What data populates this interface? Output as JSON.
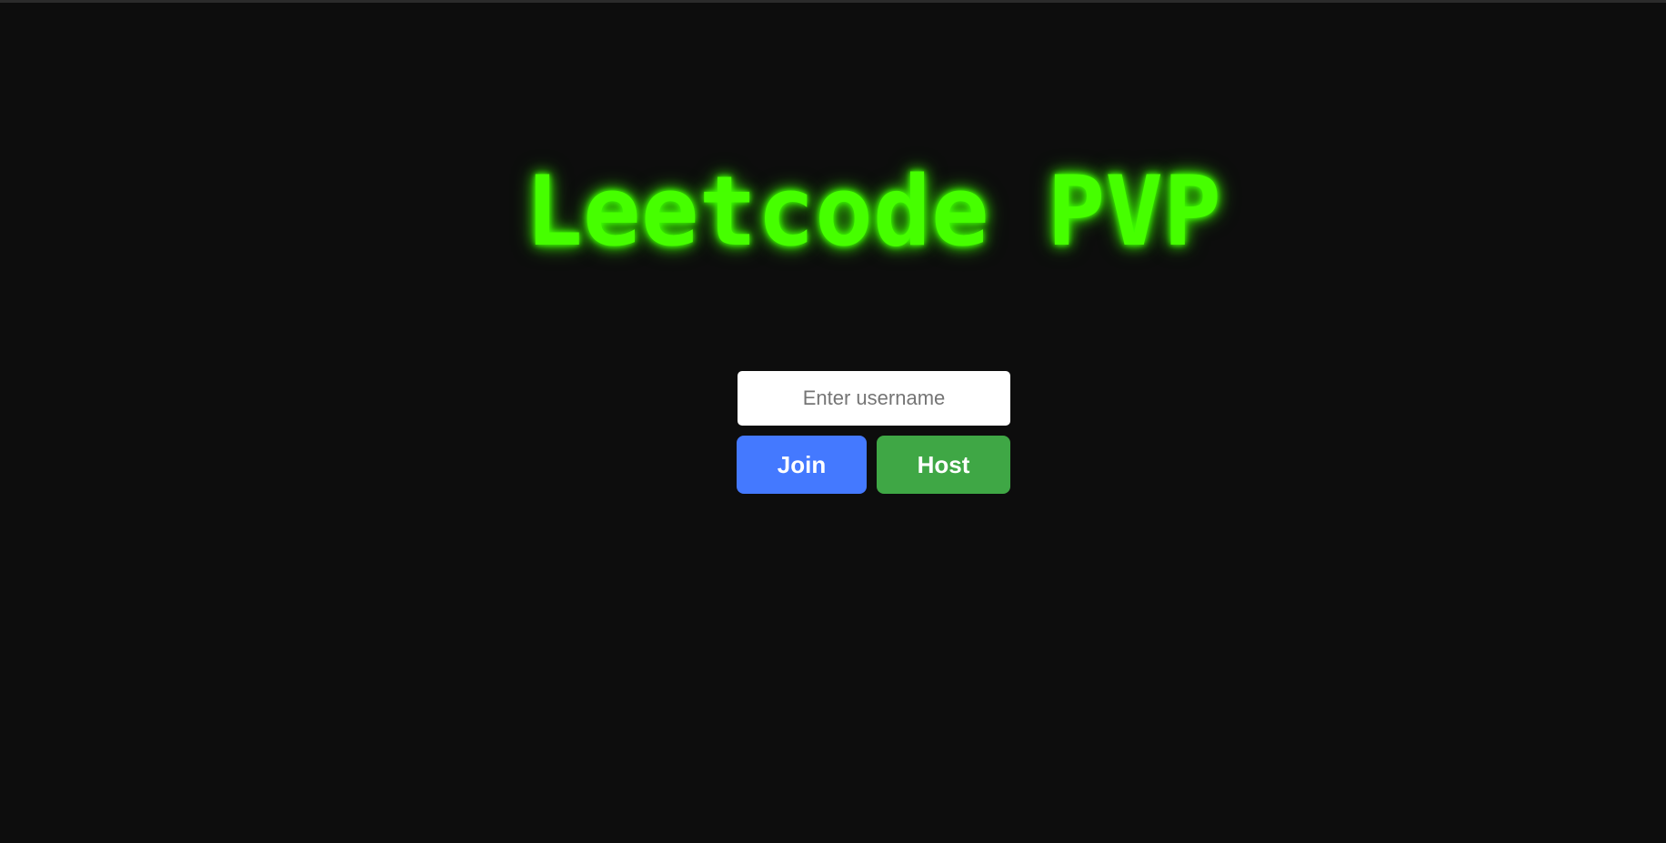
{
  "app": {
    "title": "Leetcode PVP"
  },
  "login": {
    "username_placeholder": "Enter username",
    "username_value": "",
    "join_label": "Join",
    "host_label": "Host"
  },
  "colors": {
    "background": "#0d0d0d",
    "title_green": "#46ff00",
    "join_blue": "#4479ff",
    "host_green": "#3fa745"
  }
}
